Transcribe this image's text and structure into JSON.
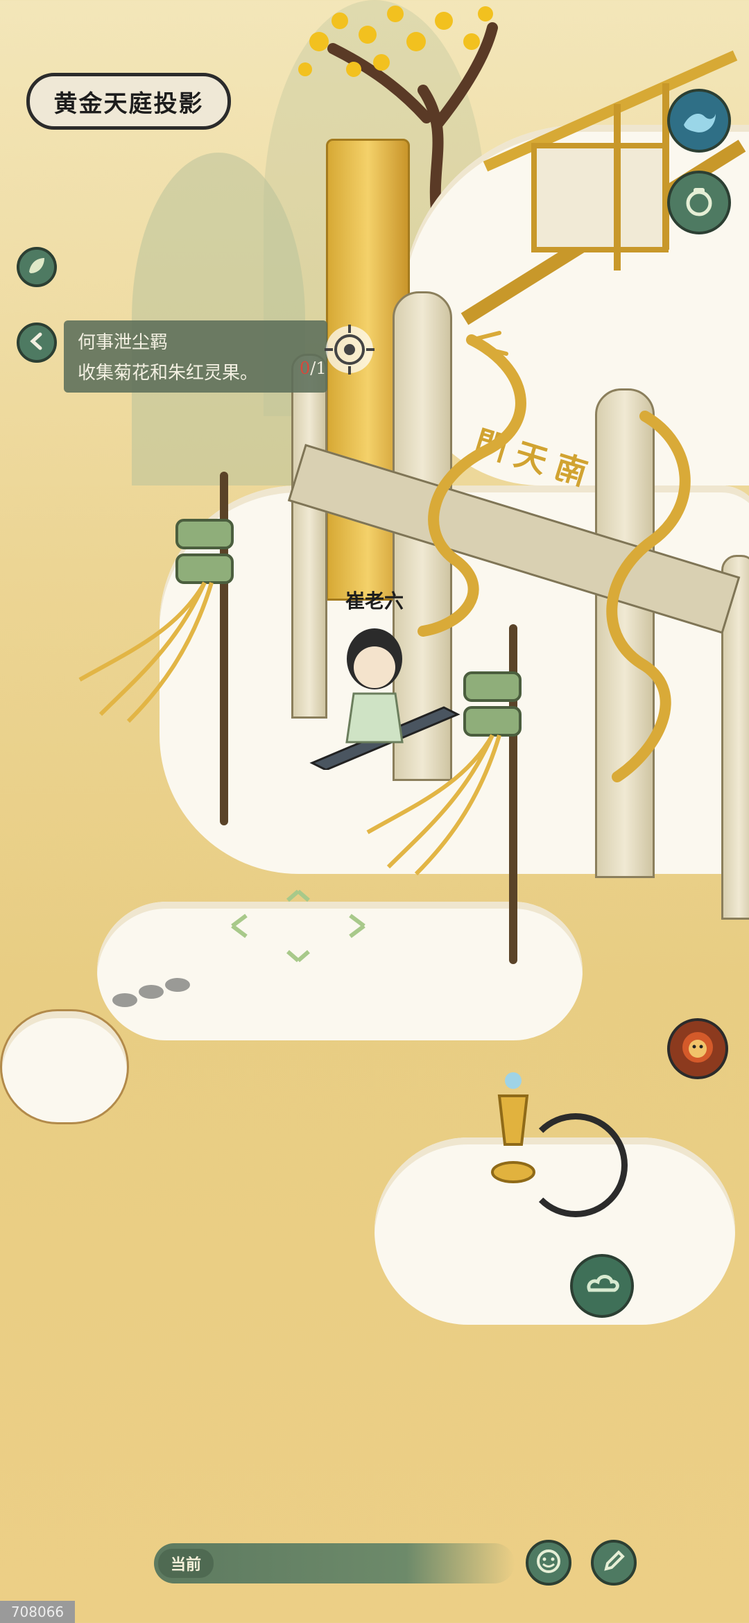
{
  "location_title": "黄金天庭投影",
  "gate_sign": "南天門",
  "quest": {
    "title": "何事泄尘羁",
    "description": "收集菊花和朱红灵果。",
    "progress_current": "0",
    "progress_total": "/1"
  },
  "npc_name": "崔老六",
  "bottom_chat": {
    "tag": "当前"
  },
  "watermark": "708066",
  "icons": {
    "top_right_1": "wave-skill-icon",
    "top_right_2": "bag-icon",
    "left_1": "leaf-icon",
    "left_2": "back-arrow-icon",
    "quest_target": "target-icon",
    "boss_portrait": "lion-demon-icon",
    "cloud_button": "cloud-icon",
    "emote": "smile-icon",
    "chat": "write-icon"
  },
  "colors": {
    "hud_green": "#4e7a62",
    "background_gold": "#ecd594",
    "gold": "#e1b23e"
  }
}
